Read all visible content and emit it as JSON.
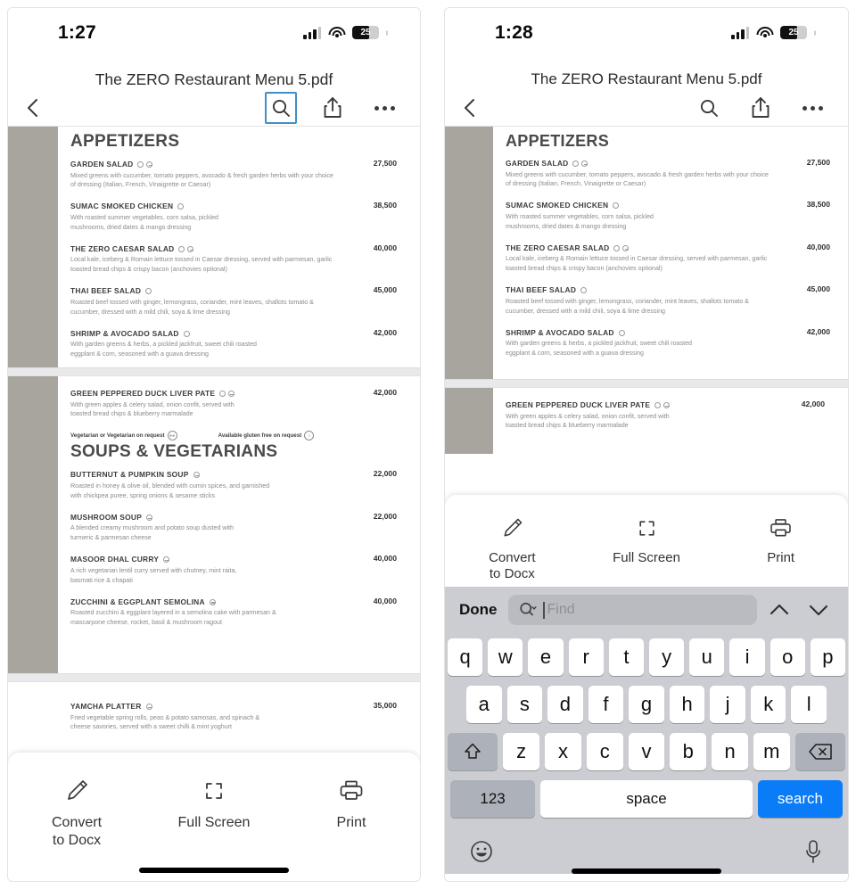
{
  "left": {
    "status": {
      "time": "1:27",
      "battery_level": "25"
    },
    "nav": {
      "doc_title": "The ZERO Restaurant Menu 5.pdf",
      "back_icon": "chevron-left-icon",
      "search_icon": "search-icon",
      "share_icon": "share-icon",
      "more_icon": "more-options-icon",
      "search_highlighted": true,
      "highlight_color": "#3e8fc9"
    },
    "sheet": {
      "convert_label": "Convert\nto Docx",
      "fullscreen_label": "Full Screen",
      "print_label": "Print"
    }
  },
  "right": {
    "status": {
      "time": "1:28",
      "battery_level": "25"
    },
    "nav": {
      "doc_title": "The ZERO Restaurant Menu 5.pdf",
      "back_icon": "chevron-left-icon",
      "search_icon": "search-icon",
      "share_icon": "share-icon",
      "more_icon": "more-options-icon",
      "search_highlighted": false
    },
    "sheet": {
      "convert_label": "Convert\nto Docx",
      "fullscreen_label": "Full Screen",
      "print_label": "Print"
    },
    "findbar": {
      "done_label": "Done",
      "search_icon": "search-dropdown-icon",
      "placeholder": "Find",
      "value": "",
      "prev_icon": "chevron-up-icon",
      "next_icon": "chevron-down-icon"
    },
    "keyboard": {
      "row1": [
        "q",
        "w",
        "e",
        "r",
        "t",
        "y",
        "u",
        "i",
        "o",
        "p"
      ],
      "row2": [
        "a",
        "s",
        "d",
        "f",
        "g",
        "h",
        "j",
        "k",
        "l"
      ],
      "row3": [
        "z",
        "x",
        "c",
        "v",
        "b",
        "n",
        "m"
      ],
      "shift_icon": "shift-icon",
      "backspace_icon": "backspace-icon",
      "numbers_label": "123",
      "space_label": "space",
      "search_label": "search",
      "emoji_icon": "emoji-icon",
      "mic_icon": "microphone-icon",
      "accent_color": "#0a7cf7"
    }
  },
  "document": {
    "page1": {
      "section_title": "APPETIZERS",
      "items": [
        {
          "name": "GARDEN SALAD",
          "marks": [
            "gluten-free",
            "vegetarian"
          ],
          "price": "27,500",
          "desc": "Mixed greens with cucumber, tomato peppers, avocado & fresh garden herbs with your choice of dressing (Italian, French, Vinaigrette or Caesar)"
        },
        {
          "name": "SUMAC SMOKED CHICKEN",
          "marks": [
            "gluten-free"
          ],
          "price": "38,500",
          "desc": "With roasted summer vegetables, corn salsa, pickled mushrooms, dried dates & mango dressing"
        },
        {
          "name": "THE ZERO CAESAR SALAD",
          "marks": [
            "gluten-free",
            "vegetarian"
          ],
          "price": "40,000",
          "desc": "Local kale, iceberg & Romain lettuce tossed in Caesar dressing, served with parmesan, garlic toasted bread chips & crispy bacon (anchovies optional)"
        },
        {
          "name": "THAI BEEF SALAD",
          "marks": [
            "gluten-free"
          ],
          "price": "45,000",
          "desc": "Roasted beef tossed with ginger, lemongrass, coriander, mint leaves, shallots tomato & cucumber, dressed with a mild chili, soya & lime dressing"
        },
        {
          "name": "SHRIMP & AVOCADO SALAD",
          "marks": [
            "gluten-free"
          ],
          "price": "42,000",
          "desc": "With garden greens & herbs, a pickled jackfruit, sweet chili roasted eggplant & corn, seasoned with a guava dressing"
        }
      ]
    },
    "page2": {
      "lead_item": {
        "name": "GREEN PEPPERED DUCK LIVER PATE",
        "marks": [
          "gluten-free",
          "vegetarian"
        ],
        "price": "42,000",
        "desc": "With green apples & celery salad, onion confit, served with toasted bread chips & blueberry marmalade"
      },
      "legend": [
        {
          "text": "Vegetarian or Vegetarian on request",
          "badge": "veg-badge"
        },
        {
          "text": "Available gluten free on request",
          "badge": "gluten-badge"
        }
      ],
      "section_title": "SOUPS & VEGETARIANS",
      "items": [
        {
          "name": "BUTTERNUT & PUMPKIN SOUP",
          "marks": [
            "vegetarian"
          ],
          "price": "22,000",
          "desc": "Roasted in honey & olive oil, blended with cumin spices, and garnished with chickpea puree, spring onions & sesame sticks"
        },
        {
          "name": "MUSHROOM SOUP",
          "marks": [
            "vegetarian"
          ],
          "price": "22,000",
          "desc": "A blended creamy mushroom and potato soup dusted with turmeric & parmesan cheese"
        },
        {
          "name": "MASOOR DHAL CURRY",
          "marks": [
            "vegetarian"
          ],
          "price": "40,000",
          "desc": "A rich vegetarian lentil curry served with chutney, mint raita, basmati rice & chapati"
        },
        {
          "name": "ZUCCHINI & EGGPLANT SEMOLINA",
          "marks": [
            "vegetarian"
          ],
          "price": "40,000",
          "desc": "Roasted zucchini & eggplant layered in a semolina cake with parmesan & mascarpone cheese, rocket, basil & mushroom ragout"
        }
      ]
    },
    "page3": {
      "items": [
        {
          "name": "YAMCHA PLATTER",
          "marks": [
            "vegetarian"
          ],
          "price": "35,000",
          "desc": "Fried vegetable spring rolls, peas & potato samosas, and spinach & cheese savories, served with a sweet chilli & mint yoghurt"
        }
      ]
    }
  }
}
